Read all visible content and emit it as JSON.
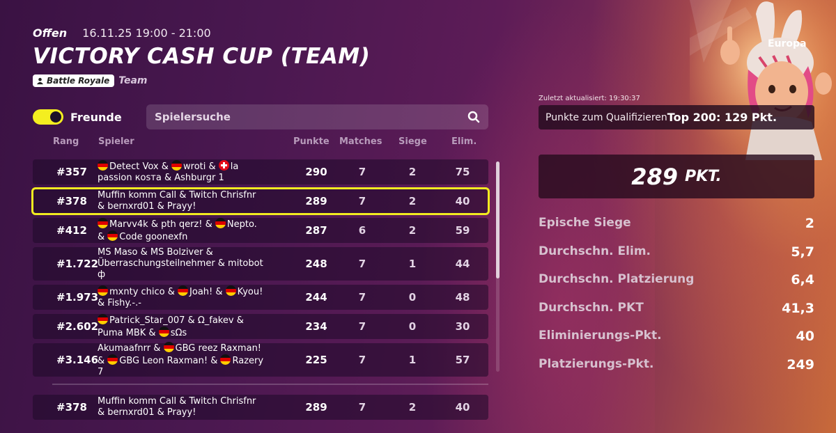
{
  "header": {
    "status": "Offen",
    "date_range": "16.11.25 19:00 - 21:00",
    "title": "VICTORY CASH CUP (TEAM)",
    "mode": "Battle Royale",
    "format": "Team"
  },
  "controls": {
    "friends_label": "Freunde",
    "friends_toggle_on": true,
    "search_placeholder": "Spielersuche"
  },
  "table": {
    "columns": [
      "Rang",
      "Spieler",
      "Punkte",
      "Matches",
      "Siege",
      "Elim."
    ],
    "rows": [
      {
        "rank": "#357",
        "player_lines": [
          "Detect Vox & ",
          "wroti & ",
          "la",
          "passion коsта & Ashburgr 1"
        ],
        "points": "290",
        "matches": "7",
        "wins": "2",
        "elims": "75"
      },
      {
        "rank": "#378",
        "player_lines": [
          "Muffin komm Call & Twitch Chrisfnr",
          "& bernxrd01 & Prayy!"
        ],
        "points": "289",
        "matches": "7",
        "wins": "2",
        "elims": "40"
      },
      {
        "rank": "#412",
        "player_lines": [
          "Marvv4k & pth qerz! & ",
          "Nepto.",
          "& ",
          "Code goonexfn"
        ],
        "points": "287",
        "matches": "6",
        "wins": "2",
        "elims": "59"
      },
      {
        "rank": "#1.722",
        "player_lines": [
          "MS Maso & MS Bolziver &",
          "Überraschungsteilnehmer & mitobot",
          "ф"
        ],
        "points": "248",
        "matches": "7",
        "wins": "1",
        "elims": "44"
      },
      {
        "rank": "#1.973",
        "player_lines": [
          "mxnty chico & ",
          "Joah! & ",
          "Kyou!",
          "& Fishy.-.-"
        ],
        "points": "244",
        "matches": "7",
        "wins": "0",
        "elims": "48"
      },
      {
        "rank": "#2.602",
        "player_lines": [
          "Patrick_Star_007 & Ω_fakev &",
          "Puma MBK & ",
          "sΩs"
        ],
        "points": "234",
        "matches": "7",
        "wins": "0",
        "elims": "30"
      },
      {
        "rank": "#3.146",
        "player_lines": [
          "Akumaafnrr & ",
          "GBG reez Raxman!",
          "& ",
          "GBG Leon Raxman! & ",
          "Razery",
          "7"
        ],
        "points": "225",
        "matches": "7",
        "wins": "1",
        "elims": "57"
      }
    ],
    "pinned": {
      "rank": "#378",
      "player_lines": [
        "Muffin komm Call & Twitch Chrisfnr",
        "& bernxrd01 & Prayy!"
      ],
      "points": "289",
      "matches": "7",
      "wins": "2",
      "elims": "40"
    }
  },
  "panel": {
    "region": "Europa",
    "last_updated": "Zuletzt aktualisiert: 19:30:37",
    "qualify_label": "Punkte zum Qualifizieren",
    "qualify_value": "Top 200: 129 Pkt.",
    "total_points": "289",
    "total_unit": "PKT.",
    "stats": [
      {
        "label": "Epische Siege",
        "value": "2"
      },
      {
        "label": "Durchschn. Elim.",
        "value": "5,7"
      },
      {
        "label": "Durchschn. Platzierung",
        "value": "6,4"
      },
      {
        "label": "Durchschn. PKT",
        "value": "41,3"
      },
      {
        "label": "Eliminierungs-Pkt.",
        "value": "40"
      },
      {
        "label": "Platzierungs-Pkt.",
        "value": "249"
      }
    ]
  },
  "colors": {
    "accent_yellow": "#f2eb20",
    "row_bg": "#2a0f33",
    "header_text": "#b89bbb"
  }
}
